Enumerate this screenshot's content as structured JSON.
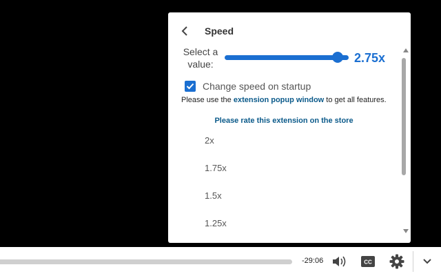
{
  "panel": {
    "title": "Speed",
    "back_icon": "chevron-left-icon",
    "select_label": "Select a value:",
    "slider": {
      "value": 2.75,
      "min": 0.25,
      "max": 3,
      "display": "2.75x"
    },
    "startup": {
      "checked": true,
      "label": "Change speed on startup"
    },
    "info": {
      "prefix": "Please use the ",
      "link": "extension popup window",
      "suffix": " to get all features."
    },
    "rate_link": "Please rate this extension on the store",
    "speed_options": [
      "2x",
      "1.75x",
      "1.5x",
      "1.25x"
    ]
  },
  "player": {
    "time_remaining": "-29:06",
    "icons": [
      "volume-icon",
      "closed-captions-icon",
      "settings-gear-icon",
      "chevron-down-icon"
    ]
  },
  "colors": {
    "accent": "#1b6fd1",
    "link": "#0b5a8a",
    "background": "#000000"
  }
}
